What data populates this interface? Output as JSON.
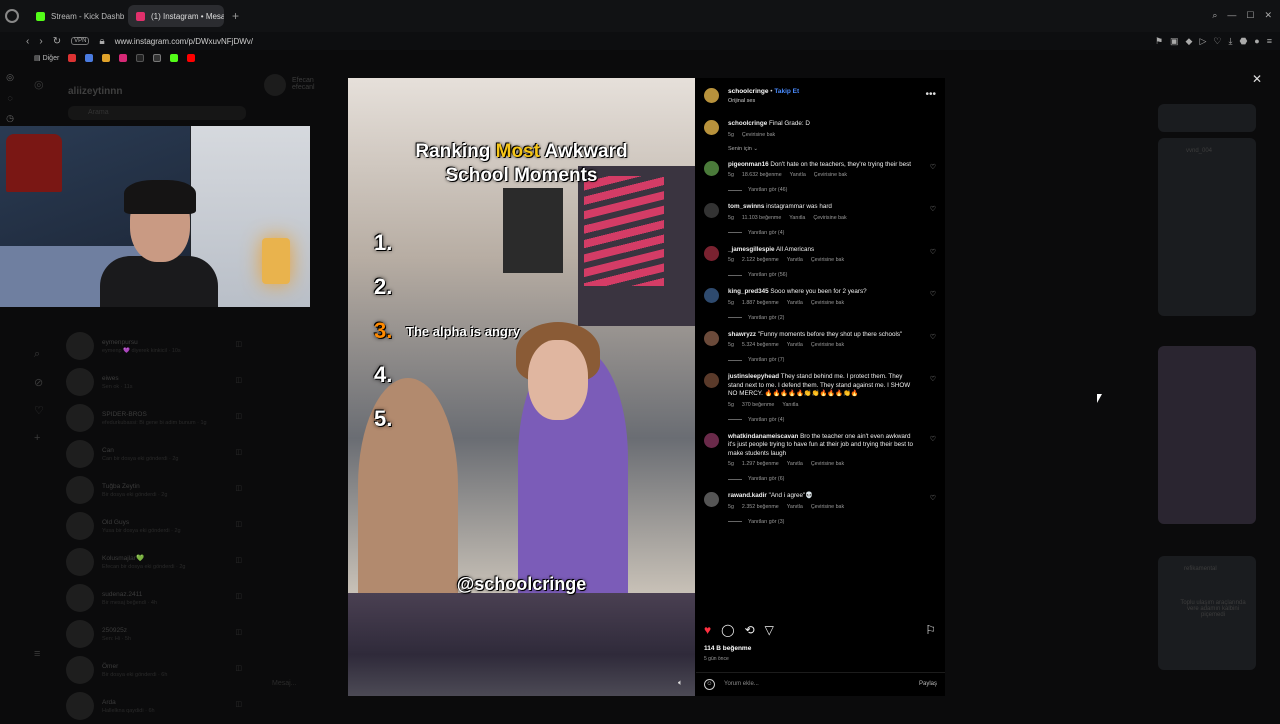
{
  "browser": {
    "tabs": [
      {
        "label": "Stream - Kick Dashboa",
        "color": "#53fc18"
      },
      {
        "label": "(1) Instagram • Mesaj",
        "color": "#e1306c"
      }
    ],
    "url": "www.instagram.com/p/DWxuvNFjDWv/",
    "vpn_label": "VPN",
    "bookmarks_folder": "Diğer"
  },
  "instagram_bg": {
    "username": "aliizeytinnn",
    "search_placeholder": "Arama",
    "chat_name": "Efecan",
    "chat_sub": "efecanl",
    "dms": [
      {
        "name": "eymenpursu",
        "msg": "eymenp 💜 diyerek kinkicil · 10s"
      },
      {
        "name": "eiwes",
        "msg": "Sen ok · 11s"
      },
      {
        "name": "SPIDER-BROS",
        "msg": "efedurkubassi: Bi gene bi adim bunum · 1g"
      },
      {
        "name": "Can",
        "msg": "Can bir dosya eki gönderdi · 2g"
      },
      {
        "name": "Tuğba Zeytin",
        "msg": "Bir dosya eki gönderdi · 2g"
      },
      {
        "name": "Old Guys",
        "msg": "Yusa bir dosya eki gönderdi · 2g"
      },
      {
        "name": "Kolusmajlar💚",
        "msg": "Efecan bir dosya eki gönderdi · 2g"
      },
      {
        "name": "sudenaz.2411",
        "msg": "Bir mesaj beğendi · 4h"
      },
      {
        "name": "250925z",
        "msg": "Sen: Hi · 5h"
      },
      {
        "name": "Ömer",
        "msg": "Bir dosya eki gönderdi · 6h"
      },
      {
        "name": "Arda",
        "msg": "Hallelkna qaydidi · 6h"
      }
    ],
    "message_placeholder": "Mesaj...",
    "right_thumbs": [
      {
        "label": "vvnd_004"
      },
      {
        "label": "refikamental"
      },
      {
        "label": "Toplu ulaşım araçlarında vere adamın kalbini piçemedi"
      }
    ]
  },
  "video": {
    "title_line1_pre": "Ranking",
    "title_line1_hl": "Most",
    "title_line1_post": "Awkward",
    "title_line2": "School Moments",
    "ranks": [
      "1.",
      "2.",
      "3.",
      "4.",
      "5."
    ],
    "rank3_text": "The alpha is angry",
    "handle": "@schoolcringe",
    "mute_icon": "speaker-mute-icon"
  },
  "post": {
    "author": "schoolcringe",
    "sep": "•",
    "follow": "Takip Et",
    "audio": "Orijinal ses",
    "caption_user": "schoolcringe",
    "caption": "Final Grade: D",
    "caption_time": "5g",
    "caption_translate": "Çevirisine bak",
    "for_you": "Senin için",
    "comments": [
      {
        "user": "pigeonman16",
        "text": "Don't hate on the teachers, they're trying their best",
        "time": "5g",
        "likes": "18.632 beğenme",
        "reply": "Yanıtla",
        "translate": "Çevirisine bak",
        "replies": "Yanıtları gör (46)",
        "color": "#4a7a3a"
      },
      {
        "user": "tom_swinns",
        "text": "instagrammar was hard",
        "time": "5g",
        "likes": "11.103 beğenme",
        "reply": "Yanıtla",
        "translate": "Çevirisine bak",
        "replies": "Yanıtları gör (4)",
        "color": "#333"
      },
      {
        "user": "_jamesgillespie",
        "text": "All Americans",
        "time": "5g",
        "likes": "2.122 beğenme",
        "reply": "Yanıtla",
        "translate": "Çevirisine bak",
        "replies": "Yanıtları gör (56)",
        "color": "#7a2230"
      },
      {
        "user": "king_pred345",
        "text": "Sooo where you been for 2 years?",
        "time": "5g",
        "likes": "1.887 beğenme",
        "reply": "Yanıtla",
        "translate": "Çevirisine bak",
        "replies": "Yanıtları gör (2)",
        "color": "#2e4a6e"
      },
      {
        "user": "shawryzz",
        "text": "\"Funny moments before they shot up there schools\"",
        "time": "5g",
        "likes": "5.324 beğenme",
        "reply": "Yanıtla",
        "translate": "Çevirisine bak",
        "replies": "Yanıtları gör (7)",
        "color": "#6b4a3a"
      },
      {
        "user": "justinsleepyhead",
        "text": "They stand behind me. I protect them. They stand next to me. I defend them. They stand against me. I SHOW NO MERCY. 🔥🔥🔥🔥🔥👏👏🔥🔥🔥👏🔥",
        "time": "5g",
        "likes": "370 beğenme",
        "reply": "Yanıtla",
        "translate": "",
        "replies": "Yanıtları gör (4)",
        "color": "#5a3a2a"
      },
      {
        "user": "whatkindanameiscavan",
        "text": "Bro the teacher one ain't even awkward it's just people trying to have fun at their job and trying their best to make students laugh",
        "time": "5g",
        "likes": "1.297 beğenme",
        "reply": "Yanıtla",
        "translate": "Çevirisine bak",
        "replies": "Yanıtları gör (6)",
        "color": "#6a2a4a"
      },
      {
        "user": "rawand.kadir",
        "text": "\"And i agree\"💀",
        "time": "5g",
        "likes": "2.352 beğenme",
        "reply": "Yanıtla",
        "translate": "Çevirisine bak",
        "replies": "Yanıtları gör (3)",
        "color": "#555"
      }
    ],
    "likes_count": "114 B beğenme",
    "posted": "5 gün önce",
    "comment_placeholder": "Yorum ekle...",
    "share": "Paylaş"
  }
}
